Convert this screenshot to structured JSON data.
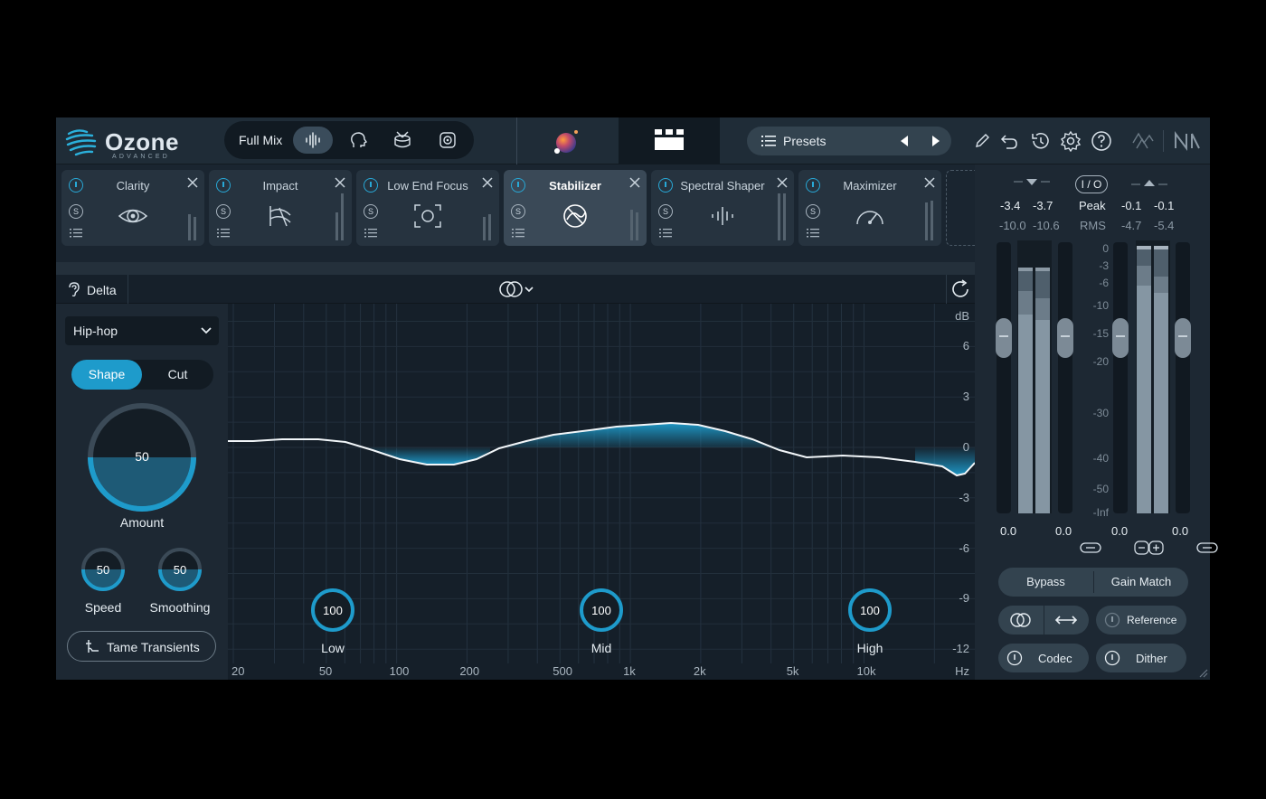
{
  "app": {
    "logo_name": "Ozone",
    "logo_sub": "ADVANCED"
  },
  "topbar": {
    "mix_label": "Full Mix",
    "mix_icons": [
      "waveform-icon",
      "vocal-head-icon",
      "drum-icon",
      "speaker-icon"
    ],
    "presets_label": "Presets",
    "tools": [
      "pencil-icon",
      "undo-icon",
      "history-icon",
      "gear-icon",
      "help-icon",
      "sync-icon",
      "ni-logo-icon"
    ]
  },
  "modules": [
    {
      "name": "Clarity",
      "icon": "eye-icon",
      "active": false
    },
    {
      "name": "Impact",
      "icon": "impact-icon",
      "active": false
    },
    {
      "name": "Low End Focus",
      "icon": "focus-target-icon",
      "active": false
    },
    {
      "name": "Stabilizer",
      "icon": "stabilizer-icon",
      "active": true
    },
    {
      "name": "Spectral Shaper",
      "icon": "spectral-icon",
      "active": false
    },
    {
      "name": "Maximizer",
      "icon": "gauge-icon",
      "active": false
    }
  ],
  "editor": {
    "delta_label": "Delta",
    "mode_icon": "stereo-link-icon",
    "preset": "Hip-hop",
    "shape_label": "Shape",
    "cut_label": "Cut",
    "amount": {
      "value": "50",
      "label": "Amount",
      "fraction": 0.5
    },
    "speed": {
      "value": "50",
      "label": "Speed",
      "fraction": 0.5
    },
    "smoothing": {
      "value": "50",
      "label": "Smoothing",
      "fraction": 0.5
    },
    "tame_label": "Tame Transients"
  },
  "graph": {
    "db_unit": "dB",
    "db_ticks": [
      "6",
      "3",
      "0",
      "-3",
      "-6",
      "-9",
      "-12"
    ],
    "hz_ticks": [
      "20",
      "50",
      "100",
      "200",
      "500",
      "1k",
      "2k",
      "5k",
      "10k"
    ],
    "hz_unit": "Hz",
    "bands": [
      {
        "label": "Low",
        "value": "100"
      },
      {
        "label": "Mid",
        "value": "100"
      },
      {
        "label": "High",
        "value": "100"
      }
    ]
  },
  "meters": {
    "in_peak": [
      "-3.4",
      "-3.7"
    ],
    "in_rms": [
      "-10.0",
      "-10.6"
    ],
    "io_label": "I / O",
    "peak_label": "Peak",
    "rms_label": "RMS",
    "out_peak": [
      "-0.1",
      "-0.1"
    ],
    "out_rms": [
      "-4.7",
      "-5.4"
    ],
    "scale": [
      "0",
      "-3",
      "-6",
      "-10",
      "-15",
      "-20",
      "-30",
      "-40",
      "-50",
      "-Inf"
    ],
    "gains": [
      "0.0",
      "0.0",
      "0.0",
      "0.0"
    ],
    "bypass_label": "Bypass",
    "gainmatch_label": "Gain Match",
    "reference_label": "Reference",
    "codec_label": "Codec",
    "dither_label": "Dither"
  },
  "colors": {
    "accent": "#1e9bcb",
    "panel": "#1a2530",
    "graph_bg": "#151f29"
  }
}
